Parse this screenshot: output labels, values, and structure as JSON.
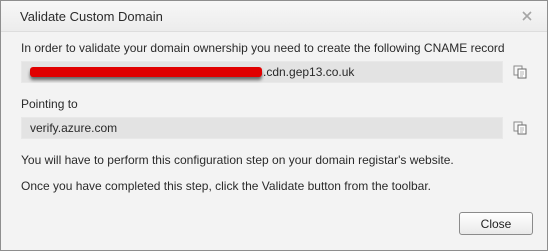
{
  "dialog": {
    "title": "Validate Custom Domain",
    "close_icon": "close-x-icon"
  },
  "intro_text": "In order to validate your domain ownership you need to create the following CNAME record",
  "cname": {
    "value_suffix": ".cdn.gep13.co.uk",
    "copy_icon": "copy-icon"
  },
  "pointing_label": "Pointing to",
  "pointing": {
    "value": "verify.azure.com",
    "copy_icon": "copy-icon"
  },
  "note_registrar": "You will have to perform this configuration step on your domain registar's website.",
  "note_validate": "Once you have completed this step, click the Validate button from the toolbar.",
  "buttons": {
    "close_label": "Close"
  },
  "colors": {
    "redaction": "#e00000",
    "field_bg": "#e3e3e3",
    "dialog_bg": "#f3f3f3"
  }
}
